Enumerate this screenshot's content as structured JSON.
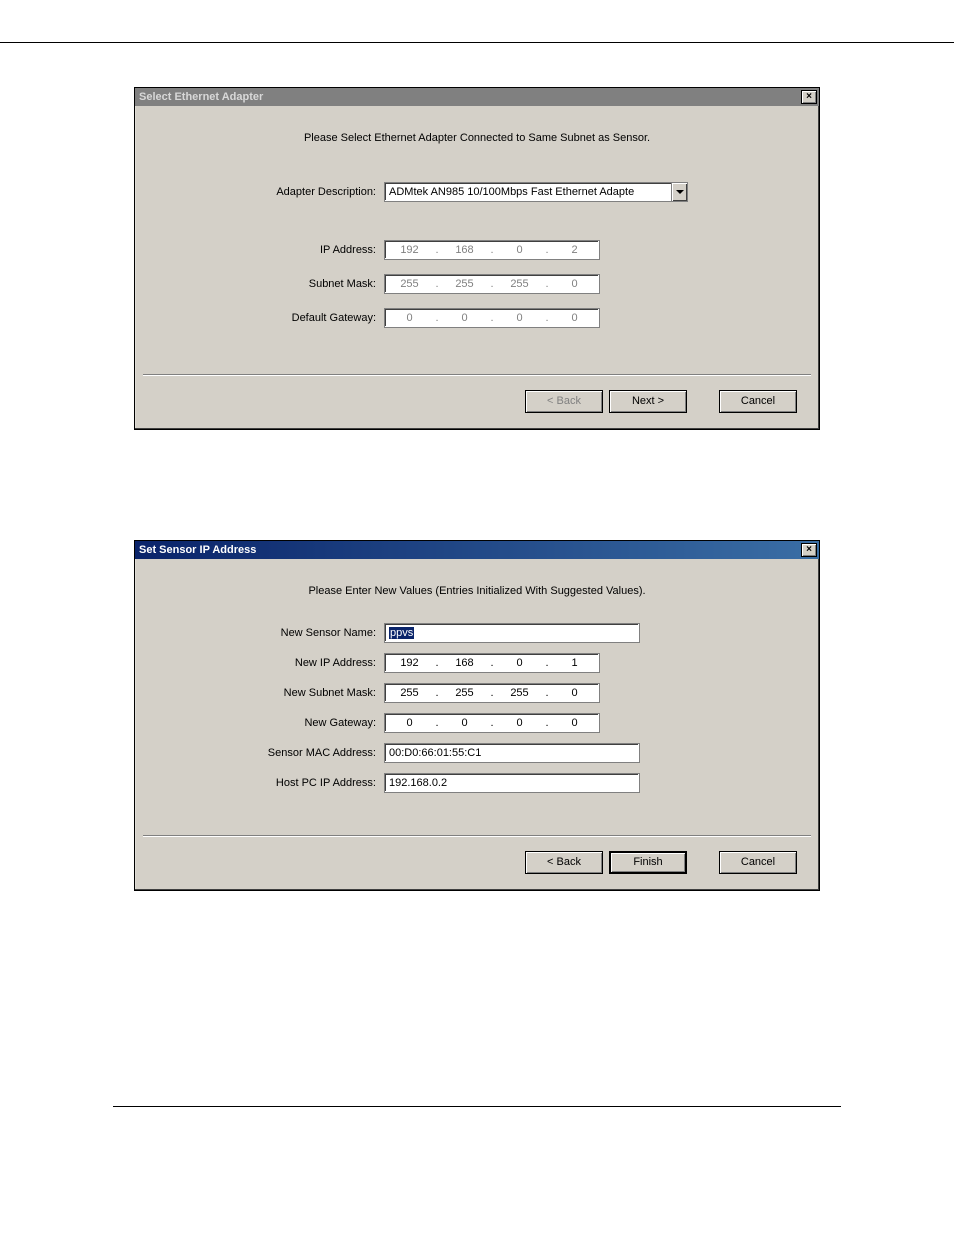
{
  "dialog1": {
    "title": "Select Ethernet Adapter",
    "close": "×",
    "instruction": "Please Select Ethernet Adapter Connected to Same Subnet as Sensor.",
    "labels": {
      "adapter": "Adapter Description:",
      "ip": "IP Address:",
      "subnet": "Subnet Mask:",
      "gateway": "Default Gateway:"
    },
    "adapter_value": "ADMtek AN985 10/100Mbps Fast Ethernet Adapte",
    "ip": [
      "192",
      "168",
      "0",
      "2"
    ],
    "subnet": [
      "255",
      "255",
      "255",
      "0"
    ],
    "gateway": [
      "0",
      "0",
      "0",
      "0"
    ],
    "buttons": {
      "back": "< Back",
      "next": "Next >",
      "cancel": "Cancel"
    }
  },
  "dialog2": {
    "title": "Set Sensor IP Address",
    "close": "×",
    "instruction": "Please Enter New Values (Entries Initialized With Suggested Values).",
    "labels": {
      "name": "New Sensor Name:",
      "ip": "New IP Address:",
      "subnet": "New Subnet Mask:",
      "gateway": "New Gateway:",
      "mac": "Sensor MAC Address:",
      "host": "Host PC IP Address:"
    },
    "name_value": "ppvs",
    "ip": [
      "192",
      "168",
      "0",
      "1"
    ],
    "subnet": [
      "255",
      "255",
      "255",
      "0"
    ],
    "gateway": [
      "0",
      "0",
      "0",
      "0"
    ],
    "mac": "00:D0:66:01:55:C1",
    "host": "192.168.0.2",
    "buttons": {
      "back": "< Back",
      "finish": "Finish",
      "cancel": "Cancel"
    }
  }
}
